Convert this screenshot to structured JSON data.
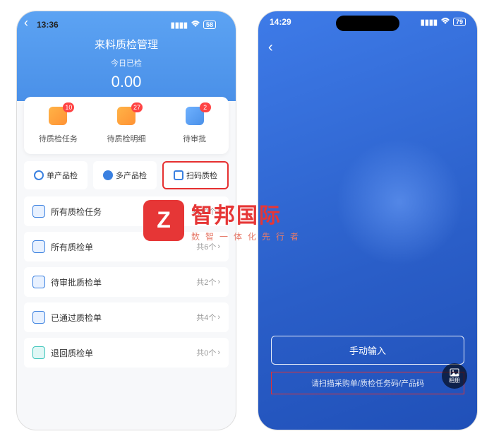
{
  "left": {
    "status": {
      "time": "13:36",
      "battery": "58"
    },
    "header": {
      "title": "来料质检管理",
      "subtitle": "今日已检",
      "value": "0.00"
    },
    "stats": [
      {
        "label": "待质检任务",
        "badge": "10"
      },
      {
        "label": "待质检明细",
        "badge": "27"
      },
      {
        "label": "待审批",
        "badge": "2"
      }
    ],
    "filters": [
      {
        "label": "单产品检"
      },
      {
        "label": "多产品检"
      },
      {
        "label": "扫码质检"
      }
    ],
    "list": [
      {
        "label": "所有质检任务",
        "count": "共10个"
      },
      {
        "label": "所有质检单",
        "count": "共6个"
      },
      {
        "label": "待审批质检单",
        "count": "共2个"
      },
      {
        "label": "已通过质检单",
        "count": "共4个"
      },
      {
        "label": "退回质检单",
        "count": "共0个"
      }
    ]
  },
  "right": {
    "status": {
      "time": "14:29",
      "battery": "79"
    },
    "manual": "手动输入",
    "hint": "请扫描采购单/质检任务码/产品码",
    "album": "相册"
  },
  "watermark": {
    "logo": "Z",
    "main": "智邦国际",
    "sub": "数智一体化先行者"
  }
}
